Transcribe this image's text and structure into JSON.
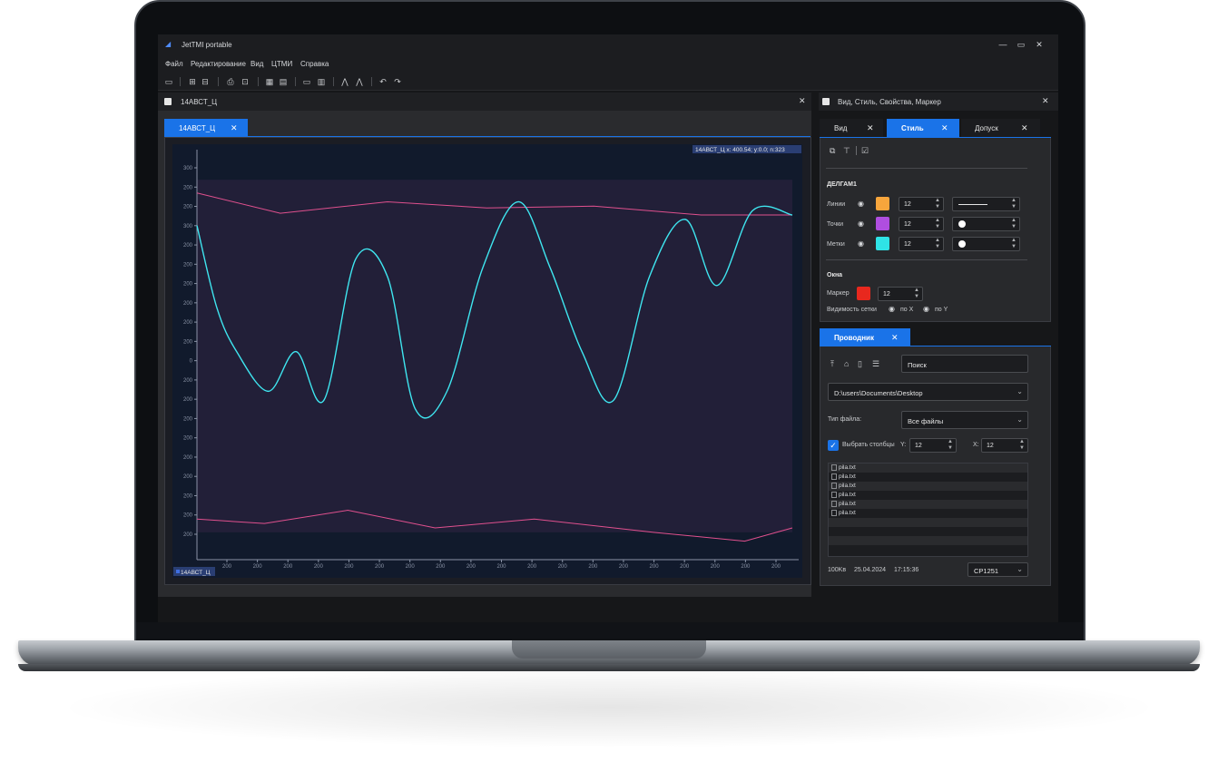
{
  "app": {
    "title": "JetTMI portable",
    "window_controls": [
      "minimize-icon",
      "maximize-icon",
      "close-icon"
    ]
  },
  "menu": [
    "Файл",
    "Редактирование",
    "Вид",
    "ЦТМИ",
    "Справка"
  ],
  "toolbar_icons": [
    "folder-open-icon",
    "import-icon",
    "export-icon",
    "print-icon",
    "print-preview-icon",
    "grid-icon",
    "layers-icon",
    "window-icon",
    "table-icon",
    "peaks-icon",
    "valley-icon",
    "undo-icon",
    "redo-icon"
  ],
  "document": {
    "header_title": "14АВСТ_Ц",
    "tab_label": "14АВСТ_Ц",
    "cursor_readout": "14АВСТ_Ц x: 400.54; y:0.0; n:323",
    "legend_label": "14АВСТ_Ц"
  },
  "chart_data": {
    "type": "line",
    "title": "",
    "xlabel": "",
    "ylabel": "",
    "x_tick_labels": [
      "200",
      "200",
      "200",
      "200",
      "200",
      "200",
      "200",
      "200",
      "200",
      "200",
      "200",
      "200",
      "200",
      "200",
      "200",
      "200",
      "200",
      "200",
      "200"
    ],
    "y_tick_labels": [
      "300",
      "200",
      "200",
      "300",
      "200",
      "200",
      "200",
      "200",
      "200",
      "200",
      "0",
      "200",
      "200",
      "200",
      "200",
      "200",
      "200",
      "200",
      "200",
      "200"
    ],
    "band": {
      "upper": 200,
      "lower": -200
    },
    "colors": {
      "signal": "#3fe6f0",
      "limits": "#e0508e",
      "band": "#241f3a",
      "background": "#111a2c"
    },
    "series": [
      {
        "values": [
          148,
          55,
          5,
          -40,
          5,
          -50,
          110,
          90,
          -60,
          -40,
          100,
          175,
          100,
          5,
          -50,
          90,
          155,
          80,
          165,
          160
        ],
        "x": [
          0,
          0.5,
          1,
          1.8,
          2.5,
          3.2,
          4,
          4.8,
          5.5,
          6.3,
          7.2,
          8.1,
          8.9,
          9.7,
          10.5,
          11.4,
          12.3,
          13.1,
          14,
          15
        ]
      },
      {
        "values": [
          185,
          162,
          175,
          168,
          170,
          160,
          160
        ],
        "x": [
          0,
          2.1,
          4.8,
          7.3,
          10,
          12.7,
          15
        ]
      },
      {
        "values": [
          -185,
          -190,
          -175,
          -195,
          -185,
          -200,
          -210,
          -195
        ],
        "x": [
          0,
          1.7,
          3.8,
          6,
          8.5,
          11.5,
          13.8,
          15
        ]
      }
    ]
  },
  "properties_panel": {
    "header_title": "Вид, Стиль, Свойства, Маркер",
    "tabs": [
      "Вид",
      "Стиль",
      "Допуск"
    ],
    "active_tab": "Стиль",
    "section_title": "ДЕЛГАМ1",
    "rows": [
      {
        "label": "Линии",
        "color": "#f7a53c",
        "value": "12",
        "style": "line"
      },
      {
        "label": "Точки",
        "color": "#b04ee0",
        "value": "12",
        "style": "dot"
      },
      {
        "label": "Метки",
        "color": "#2fe3e6",
        "value": "12",
        "style": "dot"
      }
    ],
    "window_section_title": "Окна",
    "marker_label": "Маркер",
    "marker_color": "#e8281e",
    "marker_value": "12",
    "grid_visibility_label": "Видимость сетки",
    "grid_x_label": "по X",
    "grid_y_label": "по Y"
  },
  "explorer": {
    "tab_label": "Проводник",
    "search_placeholder": "Поиск",
    "path": "D:\\users\\Documents\\Desktop",
    "file_type_label": "Тип файла:",
    "file_type_value": "Все файлы",
    "select_columns_label": "Выбрать столбцы",
    "y_label": "Y:",
    "y_value": "12",
    "x_label": "X:",
    "x_value": "12",
    "files": [
      "pila.txt",
      "pila.txt",
      "pila.txt",
      "pila.txt",
      "pila.txt",
      "pila.txt"
    ],
    "status_size": "100Kв",
    "status_date": "25.04.2024",
    "status_time": "17:15:36",
    "encoding": "CP1251"
  }
}
